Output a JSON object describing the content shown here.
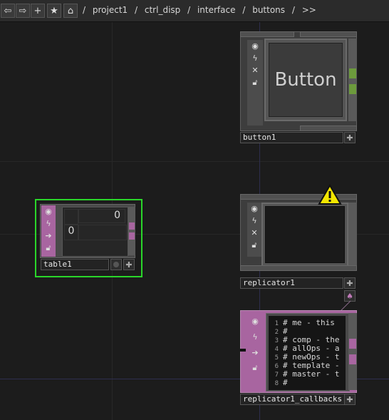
{
  "toolbar": {
    "back_icon": "arrow-left-icon",
    "forward_icon": "arrow-right-icon",
    "add_icon": "plus-icon",
    "star_icon": "star-icon",
    "home_icon": "home-icon",
    "path": [
      "/",
      "project1",
      "/",
      "ctrl_disp",
      "/",
      "interface",
      "/",
      "buttons",
      "/",
      ">>"
    ]
  },
  "nodes": {
    "button1": {
      "name": "button1",
      "viewer_text": "Button",
      "icons": [
        "viewer-icon",
        "cook-icon",
        "close-icon",
        "lock-icon"
      ]
    },
    "table1": {
      "name": "table1",
      "cells": [
        [
          "",
          "0"
        ],
        [
          "0",
          ""
        ]
      ],
      "selected_color": "#33dd33"
    },
    "replicator1": {
      "name": "replicator1",
      "warning_icon": "warning-icon",
      "warning_color": "#f3e600"
    },
    "replicator1_callbacks": {
      "name": "replicator1_callbacks",
      "lines": [
        {
          "n": "1",
          "text": "# me - this"
        },
        {
          "n": "2",
          "text": "#"
        },
        {
          "n": "3",
          "text": "# comp - the"
        },
        {
          "n": "4",
          "text": "# allOps - a"
        },
        {
          "n": "5",
          "text": "# newOps - t"
        },
        {
          "n": "6",
          "text": "# template -"
        },
        {
          "n": "7",
          "text": "# master - t"
        },
        {
          "n": "8",
          "text": "#"
        }
      ]
    }
  },
  "colors": {
    "dat_family": "#a865a0",
    "comp_family": "#5b5b5b",
    "connector_green": "#6c9a3c",
    "selection_green": "#2ad62a"
  }
}
